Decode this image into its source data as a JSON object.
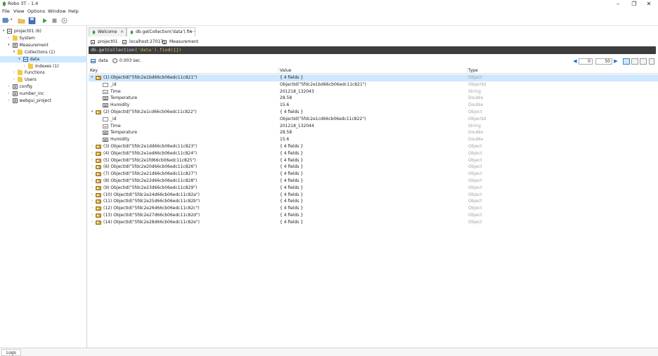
{
  "window": {
    "title": "Robo 3T - 1.4",
    "controls": {
      "minimize": "–",
      "maximize": "❐",
      "close": "✕"
    }
  },
  "menu": [
    "File",
    "View",
    "Options",
    "Window",
    "Help"
  ],
  "sidebar": {
    "items": [
      {
        "label": "project01 (6)",
        "indent": 0,
        "arrow": "▾",
        "icon": "server"
      },
      {
        "label": "System",
        "indent": 1,
        "arrow": "›",
        "icon": "folder"
      },
      {
        "label": "Measurement",
        "indent": 1,
        "arrow": "▾",
        "icon": "db"
      },
      {
        "label": "Collections (1)",
        "indent": 2,
        "arrow": "▾",
        "icon": "folder"
      },
      {
        "label": "data",
        "indent": 3,
        "arrow": "▾",
        "icon": "collection",
        "selected": true
      },
      {
        "label": "Indexes (1)",
        "indent": 4,
        "arrow": "›",
        "icon": "folder"
      },
      {
        "label": "Functions",
        "indent": 2,
        "arrow": "›",
        "icon": "folder"
      },
      {
        "label": "Users",
        "indent": 2,
        "arrow": "›",
        "icon": "folder"
      },
      {
        "label": "config",
        "indent": 1,
        "arrow": "›",
        "icon": "db"
      },
      {
        "label": "number_inc",
        "indent": 1,
        "arrow": "›",
        "icon": "db"
      },
      {
        "label": "webgui_project",
        "indent": 1,
        "arrow": "›",
        "icon": "db"
      }
    ]
  },
  "tabs": [
    {
      "label": "Welcome",
      "close": "×"
    },
    {
      "label": "db.getCollection('data').fin···",
      "close": "×",
      "active": true
    }
  ],
  "breadcrumb": {
    "server": "project01",
    "host": "localhost:27017",
    "database": "Measurement"
  },
  "query": {
    "prefix": "db.getCollection(",
    "arg": "'data'",
    "suffix": ").find({})"
  },
  "result": {
    "collection": "data",
    "time": "0.003 sec.",
    "skip": "0",
    "limit": "50",
    "prev": "◀",
    "next": "▶"
  },
  "columns": {
    "key": "Key",
    "value": "Value",
    "type": "Type"
  },
  "rows": [
    {
      "key": "(1) ObjectId(\"5fdc2e1bd66cb06edc11c821\")",
      "value": "{ 4 fields }",
      "type": "Object",
      "level": 0,
      "expanded": true,
      "icon": "obj",
      "selected": true
    },
    {
      "key": "_id",
      "value": "ObjectId(\"5fdc2e1bd66cb06edc11c821\")",
      "type": "ObjectId",
      "level": 1,
      "icon": "id"
    },
    {
      "key": "Time",
      "value": "201218_132043",
      "type": "String",
      "level": 1,
      "icon": "str"
    },
    {
      "key": "Temperature",
      "value": "28.58",
      "type": "Double",
      "level": 1,
      "icon": "num"
    },
    {
      "key": "Humidity",
      "value": "15.6",
      "type": "Double",
      "level": 1,
      "icon": "num"
    },
    {
      "key": "(2) ObjectId(\"5fdc2e1cd66cb06edc11c822\")",
      "value": "{ 4 fields }",
      "type": "Object",
      "level": 0,
      "expanded": true,
      "icon": "obj"
    },
    {
      "key": "_id",
      "value": "ObjectId(\"5fdc2e1cd66cb06edc11c822\")",
      "type": "ObjectId",
      "level": 1,
      "icon": "id"
    },
    {
      "key": "Time",
      "value": "201218_132044",
      "type": "String",
      "level": 1,
      "icon": "str"
    },
    {
      "key": "Temperature",
      "value": "28.58",
      "type": "Double",
      "level": 1,
      "icon": "num"
    },
    {
      "key": "Humidity",
      "value": "15.6",
      "type": "Double",
      "level": 1,
      "icon": "num"
    },
    {
      "key": "(3) ObjectId(\"5fdc2e1dd66cb06edc11c823\")",
      "value": "{ 4 fields }",
      "type": "Object",
      "level": 0,
      "icon": "obj"
    },
    {
      "key": "(4) ObjectId(\"5fdc2e1ed66cb06edc11c824\")",
      "value": "{ 4 fields }",
      "type": "Object",
      "level": 0,
      "icon": "obj"
    },
    {
      "key": "(5) ObjectId(\"5fdc2e1fd66cb06edc11c825\")",
      "value": "{ 4 fields }",
      "type": "Object",
      "level": 0,
      "icon": "obj"
    },
    {
      "key": "(6) ObjectId(\"5fdc2e20d66cb06edc11c826\")",
      "value": "{ 4 fields }",
      "type": "Object",
      "level": 0,
      "icon": "obj"
    },
    {
      "key": "(7) ObjectId(\"5fdc2e21d66cb06edc11c827\")",
      "value": "{ 4 fields }",
      "type": "Object",
      "level": 0,
      "icon": "obj"
    },
    {
      "key": "(8) ObjectId(\"5fdc2e22d66cb06edc11c828\")",
      "value": "{ 4 fields }",
      "type": "Object",
      "level": 0,
      "icon": "obj"
    },
    {
      "key": "(9) ObjectId(\"5fdc2e23d66cb06edc11c829\")",
      "value": "{ 4 fields }",
      "type": "Object",
      "level": 0,
      "icon": "obj"
    },
    {
      "key": "(10) ObjectId(\"5fdc2e24d66cb06edc11c82a\")",
      "value": "{ 4 fields }",
      "type": "Object",
      "level": 0,
      "icon": "obj"
    },
    {
      "key": "(11) ObjectId(\"5fdc2e25d66cb06edc11c82b\")",
      "value": "{ 4 fields }",
      "type": "Object",
      "level": 0,
      "icon": "obj"
    },
    {
      "key": "(12) ObjectId(\"5fdc2e26d66cb06edc11c82c\")",
      "value": "{ 4 fields }",
      "type": "Object",
      "level": 0,
      "icon": "obj"
    },
    {
      "key": "(13) ObjectId(\"5fdc2e27d66cb06edc11c82d\")",
      "value": "{ 4 fields }",
      "type": "Object",
      "level": 0,
      "icon": "obj"
    },
    {
      "key": "(14) ObjectId(\"5fdc2e28d66cb06edc11c82e\")",
      "value": "{ 4 fields }",
      "type": "Object",
      "level": 0,
      "icon": "obj"
    }
  ],
  "status": {
    "logs_label": "Logs"
  }
}
